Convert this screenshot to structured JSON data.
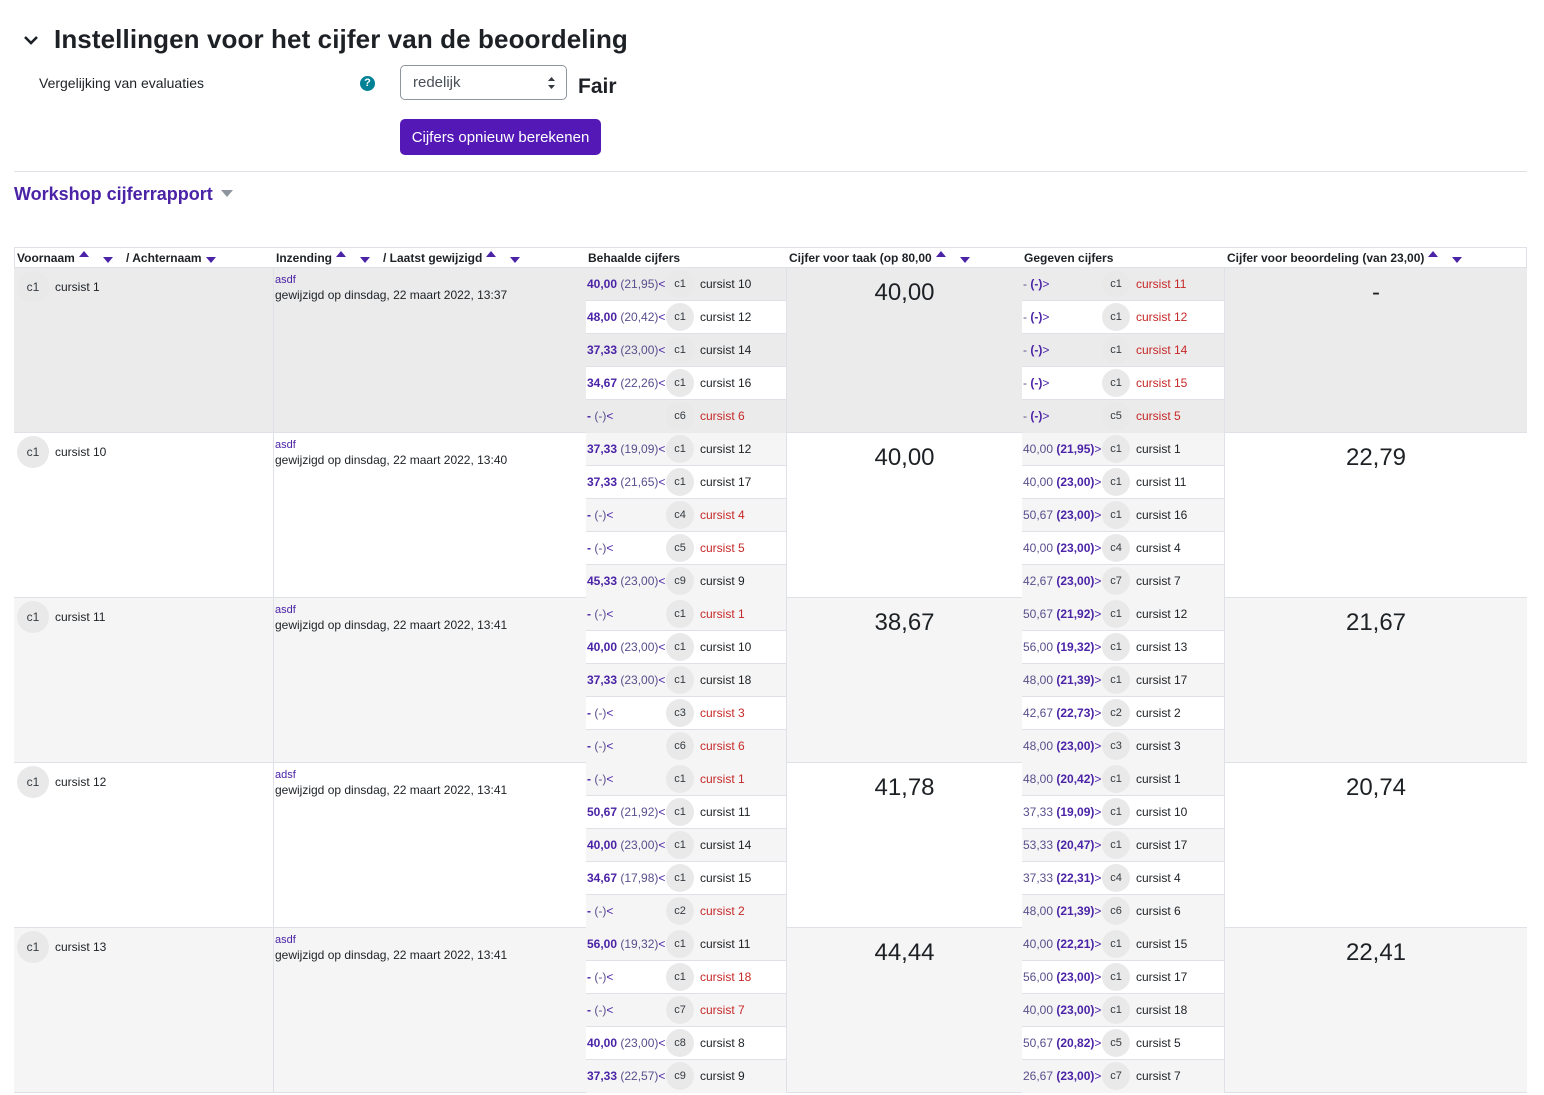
{
  "settings": {
    "title": "Instellingen voor het cijfer van de beoordeling",
    "comparison_label": "Vergelijking van evaluaties",
    "select_value": "redelijk",
    "select_caption": "Fair",
    "recalc_button": "Cijfers opnieuw berekenen",
    "report_title": "Workshop cijferrapport"
  },
  "headers": {
    "firstname": "Voornaam",
    "lastname": "/ Achternaam",
    "submission": "Inzending",
    "lastmodified": "/ Laatst gewijzigd",
    "received": "Behaalde cijfers",
    "task_grade": "Cijfer voor taak (op 80,00",
    "given": "Gegeven cijfers",
    "assessment_grade": "Cijfer voor beoordeling (van 23,00)"
  },
  "colors": {
    "accent": "#5318b5",
    "link": "#4a23a6",
    "red": "#c62828"
  },
  "rows": [
    {
      "initials": "c1",
      "name": "cursist 1",
      "sub_title": "asdf",
      "modified": "gewijzigd op dinsdag, 22 maart 2022, 13:37",
      "task_grade": "40,00",
      "assessment_grade": "-",
      "received": [
        {
          "grade": "40,00",
          "weight": "(21,95)",
          "dir": "<",
          "initials": "c1",
          "name": "cursist 10",
          "missing": false
        },
        {
          "grade": "48,00",
          "weight": "(20,42)",
          "dir": "<",
          "initials": "c1",
          "name": "cursist 12",
          "missing": false
        },
        {
          "grade": "37,33",
          "weight": "(23,00)",
          "dir": "<",
          "initials": "c1",
          "name": "cursist 14",
          "missing": false
        },
        {
          "grade": "34,67",
          "weight": "(22,26)",
          "dir": "<",
          "initials": "c1",
          "name": "cursist 16",
          "missing": false
        },
        {
          "grade": "-",
          "weight": "(-)",
          "dir": "<",
          "initials": "c6",
          "name": "cursist 6",
          "missing": true
        }
      ],
      "given": [
        {
          "grade": "-",
          "weight": "(-)",
          "dir": ">",
          "initials": "c1",
          "name": "cursist 11",
          "missing": true
        },
        {
          "grade": "-",
          "weight": "(-)",
          "dir": ">",
          "initials": "c1",
          "name": "cursist 12",
          "missing": true
        },
        {
          "grade": "-",
          "weight": "(-)",
          "dir": ">",
          "initials": "c1",
          "name": "cursist 14",
          "missing": true
        },
        {
          "grade": "-",
          "weight": "(-)",
          "dir": ">",
          "initials": "c1",
          "name": "cursist 15",
          "missing": true
        },
        {
          "grade": "-",
          "weight": "(-)",
          "dir": ">",
          "initials": "c5",
          "name": "cursist 5",
          "missing": true
        }
      ]
    },
    {
      "initials": "c1",
      "name": "cursist 10",
      "sub_title": "asdf",
      "modified": "gewijzigd op dinsdag, 22 maart 2022, 13:40",
      "task_grade": "40,00",
      "assessment_grade": "22,79",
      "received": [
        {
          "grade": "37,33",
          "weight": "(19,09)",
          "dir": "<",
          "initials": "c1",
          "name": "cursist 12",
          "missing": false
        },
        {
          "grade": "37,33",
          "weight": "(21,65)",
          "dir": "<",
          "initials": "c1",
          "name": "cursist 17",
          "missing": false
        },
        {
          "grade": "-",
          "weight": "(-)",
          "dir": "<",
          "initials": "c4",
          "name": "cursist 4",
          "missing": true
        },
        {
          "grade": "-",
          "weight": "(-)",
          "dir": "<",
          "initials": "c5",
          "name": "cursist 5",
          "missing": true
        },
        {
          "grade": "45,33",
          "weight": "(23,00)",
          "dir": "<",
          "initials": "c9",
          "name": "cursist 9",
          "missing": false
        }
      ],
      "given": [
        {
          "grade": "40,00",
          "weight": "(21,95)",
          "dir": ">",
          "initials": "c1",
          "name": "cursist 1",
          "missing": false
        },
        {
          "grade": "40,00",
          "weight": "(23,00)",
          "dir": ">",
          "initials": "c1",
          "name": "cursist 11",
          "missing": false
        },
        {
          "grade": "50,67",
          "weight": "(23,00)",
          "dir": ">",
          "initials": "c1",
          "name": "cursist 16",
          "missing": false
        },
        {
          "grade": "40,00",
          "weight": "(23,00)",
          "dir": ">",
          "initials": "c4",
          "name": "cursist 4",
          "missing": false
        },
        {
          "grade": "42,67",
          "weight": "(23,00)",
          "dir": ">",
          "initials": "c7",
          "name": "cursist 7",
          "missing": false
        }
      ]
    },
    {
      "initials": "c1",
      "name": "cursist 11",
      "sub_title": "asdf",
      "modified": "gewijzigd op dinsdag, 22 maart 2022, 13:41",
      "task_grade": "38,67",
      "assessment_grade": "21,67",
      "received": [
        {
          "grade": "-",
          "weight": "(-)",
          "dir": "<",
          "initials": "c1",
          "name": "cursist 1",
          "missing": true
        },
        {
          "grade": "40,00",
          "weight": "(23,00)",
          "dir": "<",
          "initials": "c1",
          "name": "cursist 10",
          "missing": false
        },
        {
          "grade": "37,33",
          "weight": "(23,00)",
          "dir": "<",
          "initials": "c1",
          "name": "cursist 18",
          "missing": false
        },
        {
          "grade": "-",
          "weight": "(-)",
          "dir": "<",
          "initials": "c3",
          "name": "cursist 3",
          "missing": true
        },
        {
          "grade": "-",
          "weight": "(-)",
          "dir": "<",
          "initials": "c6",
          "name": "cursist 6",
          "missing": true
        }
      ],
      "given": [
        {
          "grade": "50,67",
          "weight": "(21,92)",
          "dir": ">",
          "initials": "c1",
          "name": "cursist 12",
          "missing": false
        },
        {
          "grade": "56,00",
          "weight": "(19,32)",
          "dir": ">",
          "initials": "c1",
          "name": "cursist 13",
          "missing": false
        },
        {
          "grade": "48,00",
          "weight": "(21,39)",
          "dir": ">",
          "initials": "c1",
          "name": "cursist 17",
          "missing": false
        },
        {
          "grade": "42,67",
          "weight": "(22,73)",
          "dir": ">",
          "initials": "c2",
          "name": "cursist 2",
          "missing": false
        },
        {
          "grade": "48,00",
          "weight": "(23,00)",
          "dir": ">",
          "initials": "c3",
          "name": "cursist 3",
          "missing": false
        }
      ]
    },
    {
      "initials": "c1",
      "name": "cursist 12",
      "sub_title": "adsf",
      "modified": "gewijzigd op dinsdag, 22 maart 2022, 13:41",
      "task_grade": "41,78",
      "assessment_grade": "20,74",
      "received": [
        {
          "grade": "-",
          "weight": "(-)",
          "dir": "<",
          "initials": "c1",
          "name": "cursist 1",
          "missing": true
        },
        {
          "grade": "50,67",
          "weight": "(21,92)",
          "dir": "<",
          "initials": "c1",
          "name": "cursist 11",
          "missing": false
        },
        {
          "grade": "40,00",
          "weight": "(23,00)",
          "dir": "<",
          "initials": "c1",
          "name": "cursist 14",
          "missing": false
        },
        {
          "grade": "34,67",
          "weight": "(17,98)",
          "dir": "<",
          "initials": "c1",
          "name": "cursist 15",
          "missing": false
        },
        {
          "grade": "-",
          "weight": "(-)",
          "dir": "<",
          "initials": "c2",
          "name": "cursist 2",
          "missing": true
        }
      ],
      "given": [
        {
          "grade": "48,00",
          "weight": "(20,42)",
          "dir": ">",
          "initials": "c1",
          "name": "cursist 1",
          "missing": false
        },
        {
          "grade": "37,33",
          "weight": "(19,09)",
          "dir": ">",
          "initials": "c1",
          "name": "cursist 10",
          "missing": false
        },
        {
          "grade": "53,33",
          "weight": "(20,47)",
          "dir": ">",
          "initials": "c1",
          "name": "cursist 17",
          "missing": false
        },
        {
          "grade": "37,33",
          "weight": "(22,31)",
          "dir": ">",
          "initials": "c4",
          "name": "cursist 4",
          "missing": false
        },
        {
          "grade": "48,00",
          "weight": "(21,39)",
          "dir": ">",
          "initials": "c6",
          "name": "cursist 6",
          "missing": false
        }
      ]
    },
    {
      "initials": "c1",
      "name": "cursist 13",
      "sub_title": "asdf",
      "modified": "gewijzigd op dinsdag, 22 maart 2022, 13:41",
      "task_grade": "44,44",
      "assessment_grade": "22,41",
      "received": [
        {
          "grade": "56,00",
          "weight": "(19,32)",
          "dir": "<",
          "initials": "c1",
          "name": "cursist 11",
          "missing": false
        },
        {
          "grade": "-",
          "weight": "(-)",
          "dir": "<",
          "initials": "c1",
          "name": "cursist 18",
          "missing": true
        },
        {
          "grade": "-",
          "weight": "(-)",
          "dir": "<",
          "initials": "c7",
          "name": "cursist 7",
          "missing": true
        },
        {
          "grade": "40,00",
          "weight": "(23,00)",
          "dir": "<",
          "initials": "c8",
          "name": "cursist 8",
          "missing": false
        },
        {
          "grade": "37,33",
          "weight": "(22,57)",
          "dir": "<",
          "initials": "c9",
          "name": "cursist 9",
          "missing": false
        }
      ],
      "given": [
        {
          "grade": "40,00",
          "weight": "(22,21)",
          "dir": ">",
          "initials": "c1",
          "name": "cursist 15",
          "missing": false
        },
        {
          "grade": "56,00",
          "weight": "(23,00)",
          "dir": ">",
          "initials": "c1",
          "name": "cursist 17",
          "missing": false
        },
        {
          "grade": "40,00",
          "weight": "(23,00)",
          "dir": ">",
          "initials": "c1",
          "name": "cursist 18",
          "missing": false
        },
        {
          "grade": "50,67",
          "weight": "(20,82)",
          "dir": ">",
          "initials": "c5",
          "name": "cursist 5",
          "missing": false
        },
        {
          "grade": "26,67",
          "weight": "(23,00)",
          "dir": ">",
          "initials": "c7",
          "name": "cursist 7",
          "missing": false
        }
      ]
    }
  ]
}
